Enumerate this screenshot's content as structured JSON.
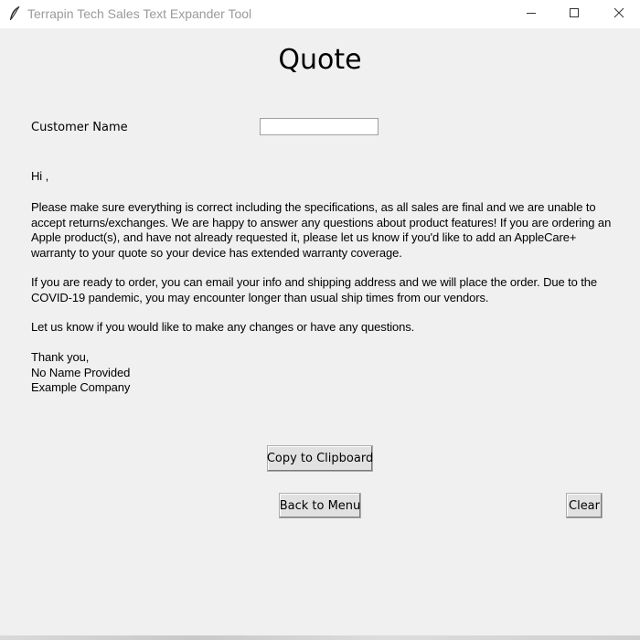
{
  "window": {
    "title": "Terrapin Tech Sales Text Expander Tool",
    "icon": "feather-icon",
    "controls": [
      "minimize-icon",
      "maximize-icon",
      "close-icon"
    ]
  },
  "form": {
    "heading": "Quote",
    "customer_label": "Customer Name",
    "customer_value": ""
  },
  "message": {
    "greeting": "Hi ,",
    "paragraph1": "Please make sure everything is correct including the specifications, as all sales are final and we are unable to accept returns/exchanges. We are happy to answer any questions about product features! If you are ordering an Apple product(s), and have not already requested it, please let us know if you'd like to add an AppleCare+ warranty to your quote so your device has extended warranty coverage.",
    "paragraph2": "If you are ready to order, you can email your info and shipping address and we will place the order. Due to the COVID-19 pandemic, you may encounter longer than usual ship times from our vendors.",
    "paragraph3": "Let us know if you would like to make any changes or have any questions.",
    "signoff": "Thank you,",
    "sender_name": "No Name Provided",
    "company": "Example Company"
  },
  "buttons": {
    "copy": "Copy to Clipboard",
    "back": "Back to Menu",
    "clear": "Clear"
  }
}
